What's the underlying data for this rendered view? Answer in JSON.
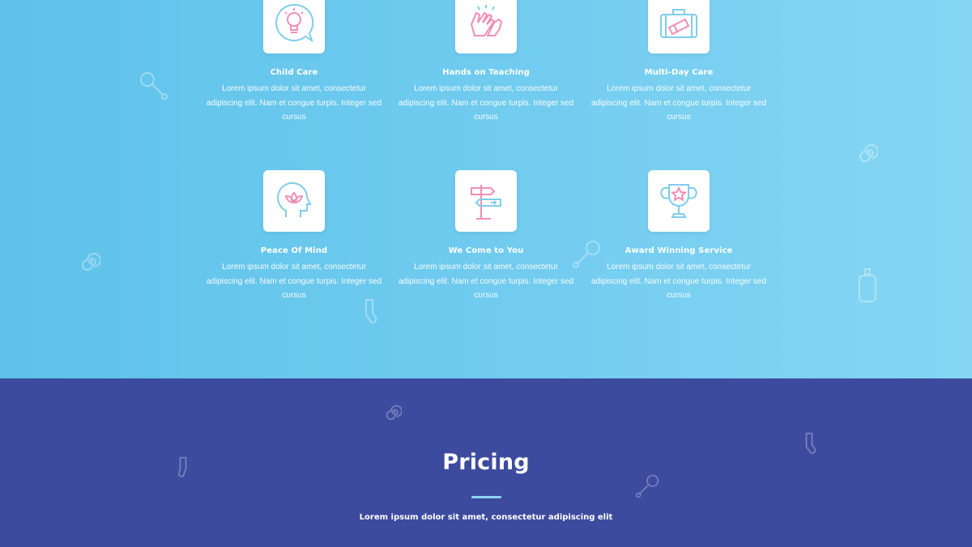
{
  "features": [
    {
      "title": "Child Care",
      "text": "Lorem ipsum dolor sit amet, consectetur adipiscing elit. Nam et congue turpis. Integer sed cursus",
      "icon": "lightbulb-chat-icon"
    },
    {
      "title": "Hands on Teaching",
      "text": "Lorem ipsum dolor sit amet, consectetur adipiscing elit. Nam et congue turpis. Integer sed cursus",
      "icon": "hands-icon"
    },
    {
      "title": "Multi-Day Care",
      "text": "Lorem ipsum dolor sit amet, consectetur adipiscing elit. Nam et congue turpis. Integer sed cursus",
      "icon": "suitcase-icon"
    },
    {
      "title": "Peace Of Mind",
      "text": "Lorem ipsum dolor sit amet, consectetur adipiscing elit. Nam et congue turpis. Integer sed cursus",
      "icon": "lotus-head-icon"
    },
    {
      "title": "We Come to You",
      "text": "Lorem ipsum dolor sit amet, consectetur adipiscing elit. Nam et congue turpis. Integer sed cursus",
      "icon": "signpost-icon"
    },
    {
      "title": "Award Winning Service",
      "text": "Lorem ipsum dolor sit amet, consectetur adipiscing elit. Nam et congue turpis. Integer sed cursus",
      "icon": "trophy-icon"
    }
  ],
  "pricing": {
    "title": "Pricing",
    "subtitle": "Lorem ipsum dolor sit amet, consectetur adipiscing elit"
  },
  "colors": {
    "features_bg": "#6ec9ee",
    "pricing_bg": "#3d4b9f",
    "icon_pink": "#f08fb3",
    "icon_blue": "#7fcde9",
    "divider": "#8fd3f2"
  }
}
